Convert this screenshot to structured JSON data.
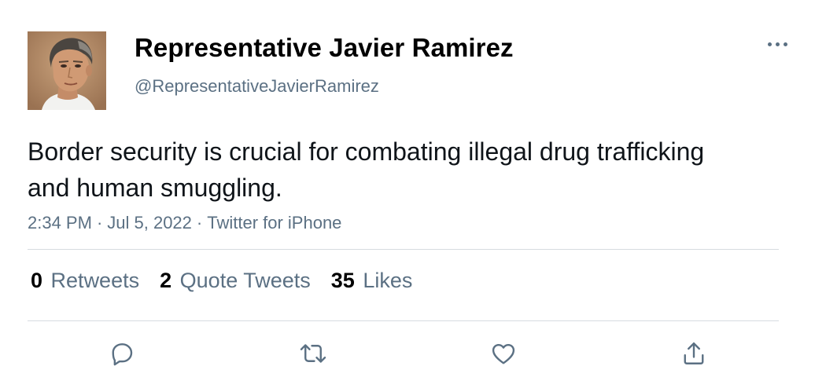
{
  "author": {
    "display_name": "Representative Javier Ramirez",
    "handle": "@RepresentativeJavierRamirez",
    "avatar_icon": "profile-photo"
  },
  "menu": {
    "icon": "more-horizontal-icon"
  },
  "tweet": {
    "text": "Border security is crucial for combating illegal drug trafficking and human smuggling.",
    "time": "2:34 PM",
    "date": "Jul 5, 2022",
    "source": "Twitter for iPhone",
    "separator": "·"
  },
  "stats": {
    "retweets": {
      "count": "0",
      "label": "Retweets"
    },
    "quote_tweets": {
      "count": "2",
      "label": "Quote Tweets"
    },
    "likes": {
      "count": "35",
      "label": "Likes"
    }
  },
  "actions": [
    {
      "name": "reply",
      "icon": "speech-bubble-icon"
    },
    {
      "name": "retweet",
      "icon": "retweet-arrows-icon"
    },
    {
      "name": "like",
      "icon": "heart-icon"
    },
    {
      "name": "share",
      "icon": "share-upload-icon"
    }
  ],
  "colors": {
    "text_primary": "#0f1419",
    "text_secondary": "#5b7083",
    "divider": "#d6dbe0",
    "icon": "#5b7083"
  }
}
